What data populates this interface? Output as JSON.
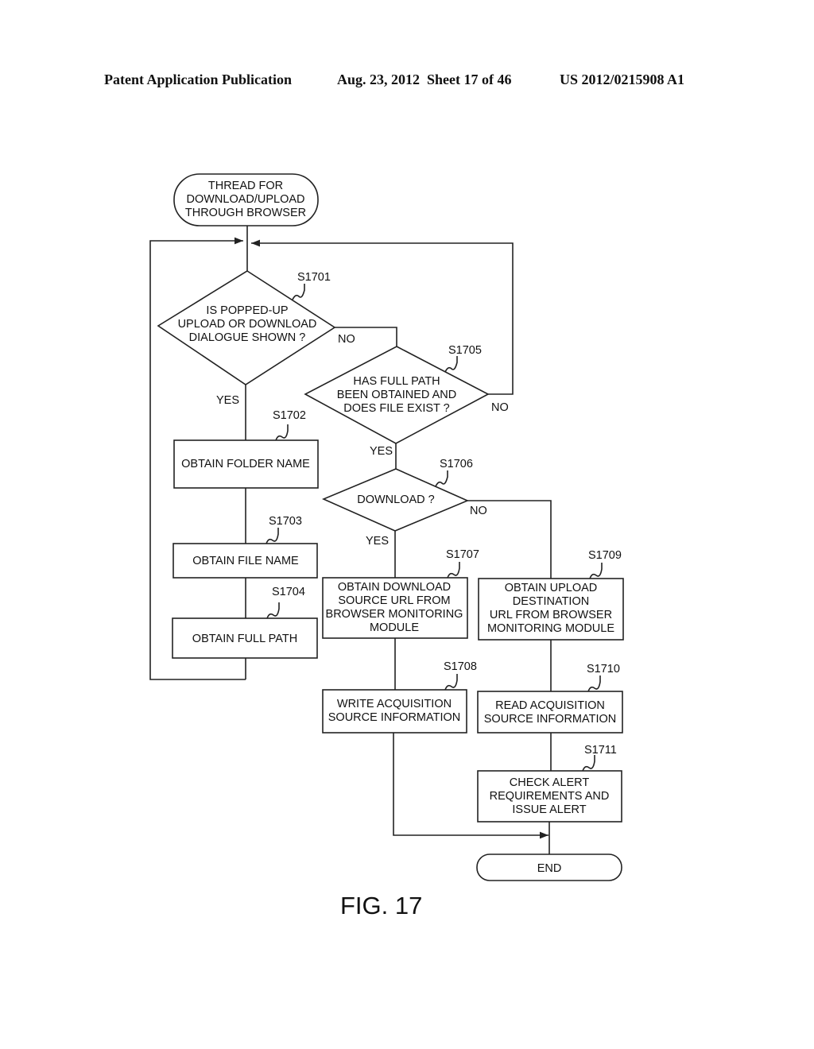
{
  "header": {
    "publication": "Patent Application Publication",
    "date_sheet": "Aug. 23, 2012  Sheet 17 of 46",
    "number": "US 2012/0215908 A1"
  },
  "flowchart": {
    "start": [
      "THREAD FOR",
      "DOWNLOAD/UPLOAD",
      "THROUGH BROWSER"
    ],
    "s1701": {
      "id": "S1701",
      "lines": [
        "IS POPPED-UP",
        "UPLOAD OR DOWNLOAD",
        "DIALOGUE SHOWN ?"
      ]
    },
    "s1702": {
      "id": "S1702",
      "lines": [
        "OBTAIN FOLDER NAME"
      ]
    },
    "s1703": {
      "id": "S1703",
      "lines": [
        "OBTAIN FILE NAME"
      ]
    },
    "s1704": {
      "id": "S1704",
      "lines": [
        "OBTAIN FULL PATH"
      ]
    },
    "s1705": {
      "id": "S1705",
      "lines": [
        "HAS FULL PATH",
        "BEEN OBTAINED AND",
        "DOES FILE EXIST ?"
      ]
    },
    "s1706": {
      "id": "S1706",
      "lines": [
        "DOWNLOAD ?"
      ]
    },
    "s1707": {
      "id": "S1707",
      "lines": [
        "OBTAIN DOWNLOAD",
        "SOURCE URL FROM",
        "BROWSER MONITORING",
        "MODULE"
      ]
    },
    "s1708": {
      "id": "S1708",
      "lines": [
        "WRITE ACQUISITION",
        "SOURCE INFORMATION"
      ]
    },
    "s1709": {
      "id": "S1709",
      "lines": [
        "OBTAIN UPLOAD",
        "DESTINATION",
        "URL FROM BROWSER",
        "MONITORING MODULE"
      ]
    },
    "s1710": {
      "id": "S1710",
      "lines": [
        "READ ACQUISITION",
        "SOURCE INFORMATION"
      ]
    },
    "s1711": {
      "id": "S1711",
      "lines": [
        "CHECK ALERT",
        "REQUIREMENTS AND",
        "ISSUE ALERT"
      ]
    },
    "end": [
      "END"
    ],
    "labels": {
      "yes": "YES",
      "no": "NO"
    }
  },
  "figure_label": "FIG. 17"
}
